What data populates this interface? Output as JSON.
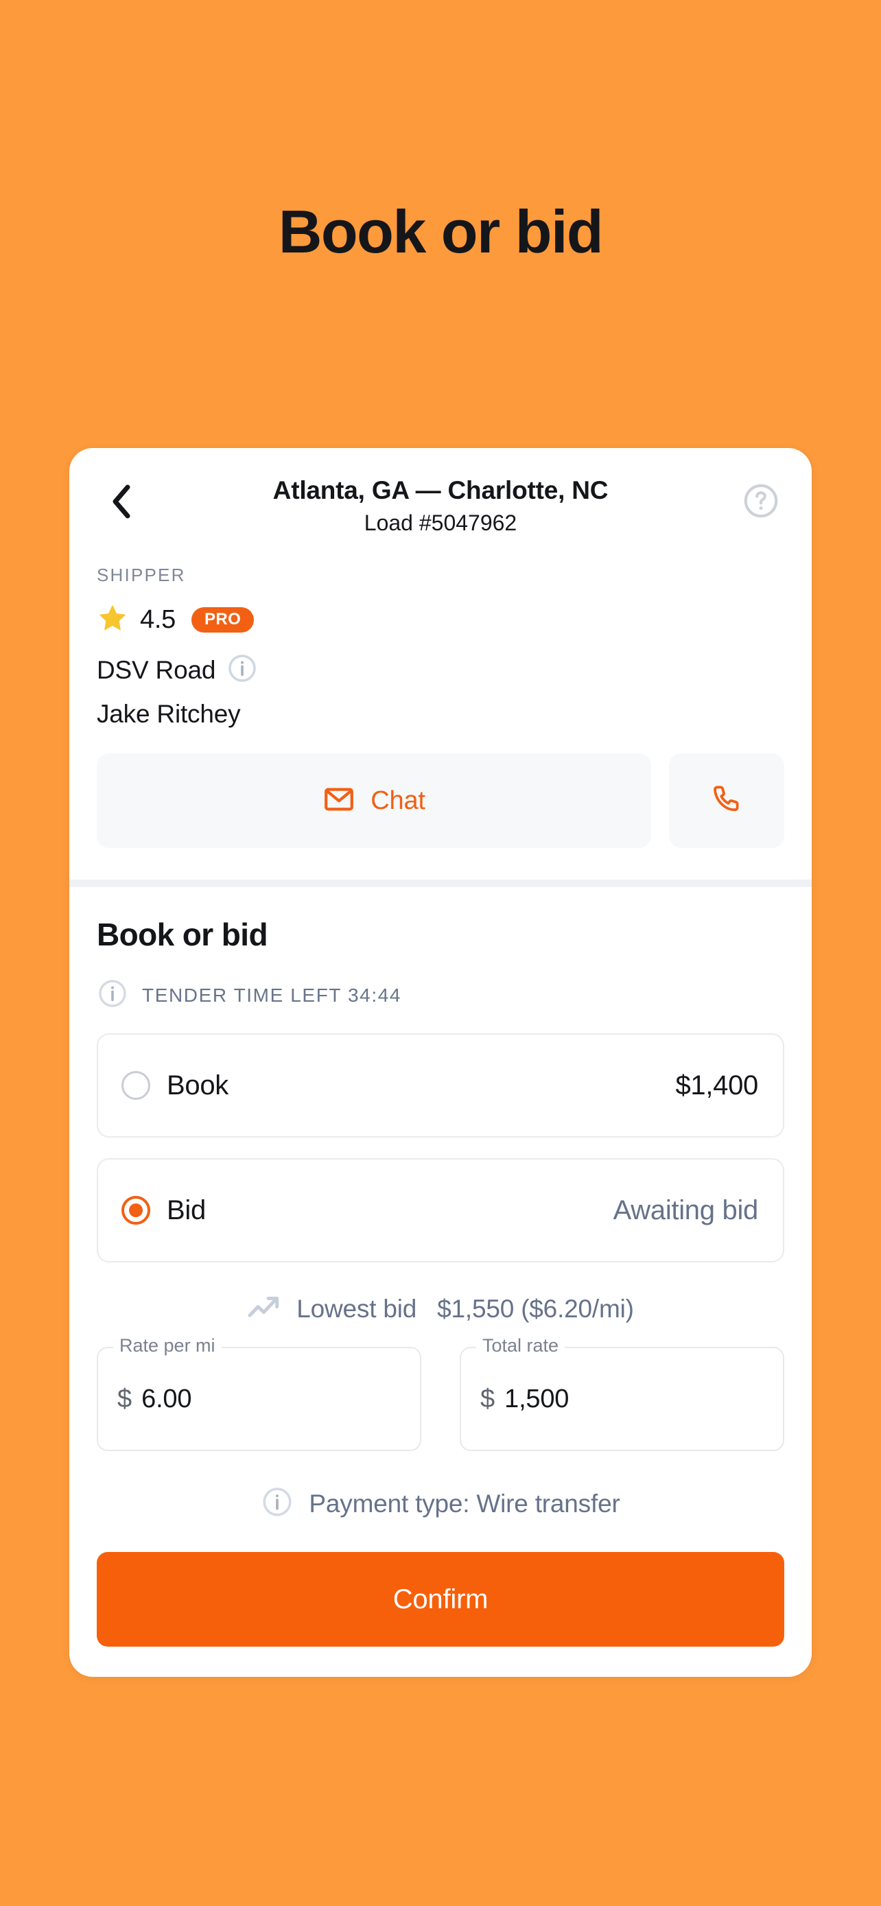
{
  "page": {
    "title": "Book or bid",
    "background_color": "#FC9A3C",
    "accent_color": "#F26014"
  },
  "card_header": {
    "back_icon": "chevron-left-icon",
    "route": "Atlanta, GA — Charlotte, NC",
    "load_id": "Load #5047962",
    "help_icon": "question-circle-icon"
  },
  "shipper": {
    "label": "SHIPPER",
    "star_icon": "star-icon",
    "rating": "4.5",
    "badge": "PRO",
    "company": "DSV Road",
    "company_info_icon": "info-circle-icon",
    "contact": "Jake Ritchey"
  },
  "communication": {
    "chat_label": "Chat",
    "chat_icon": "envelope-icon",
    "call_icon": "phone-icon"
  },
  "bid_section": {
    "title": "Book or bid",
    "tender_info_icon": "info-circle-icon",
    "tender_text": "TENDER TIME LEFT 34:44",
    "options": [
      {
        "id": "book",
        "label": "Book",
        "value": "$1,400",
        "selected": false,
        "muted_value": false
      },
      {
        "id": "bid",
        "label": "Bid",
        "value": "Awaiting bid",
        "selected": true,
        "muted_value": true
      }
    ],
    "lowest_bid": {
      "icon": "trending-up-icon",
      "label": "Lowest bid",
      "amount": "$1,550 ($6.20/mi)"
    },
    "fields": [
      {
        "id": "rate-per-mi",
        "legend": "Rate per mi",
        "prefix": "$",
        "value": "6.00"
      },
      {
        "id": "total-rate",
        "legend": "Total rate",
        "prefix": "$",
        "value": "1,500"
      }
    ],
    "payment": {
      "icon": "info-circle-icon",
      "text": "Payment type: Wire transfer"
    },
    "confirm_label": "Confirm"
  }
}
